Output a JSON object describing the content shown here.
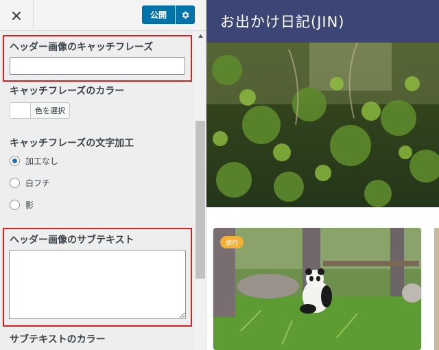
{
  "toolbar": {
    "close_icon": "close-icon",
    "publish_label": "公開",
    "settings_icon": "gear-icon"
  },
  "sections": {
    "catchphrase_title": "ヘッダー画像のキャッチフレーズ",
    "catchphrase_value": "",
    "catchphrase_color_title": "キャッチフレーズのカラー",
    "color_button_label": "色を選択",
    "catchphrase_effect_title": "キャッチフレーズの文字加工",
    "effect_options": [
      {
        "label": "加工なし",
        "checked": true
      },
      {
        "label": "白フチ",
        "checked": false
      },
      {
        "label": "影",
        "checked": false
      }
    ],
    "subtext_title": "ヘッダー画像のサブテキスト",
    "subtext_value": "",
    "subtext_color_title": "サブテキストのカラー"
  },
  "preview": {
    "site_title": "お出かけ日記(JIN)",
    "header_color": "#3b4675",
    "card_tag": "旅行",
    "card_tag_color": "#f2b035"
  },
  "colors": {
    "accent": "#0073aa",
    "highlight_border": "#e01c1c"
  }
}
